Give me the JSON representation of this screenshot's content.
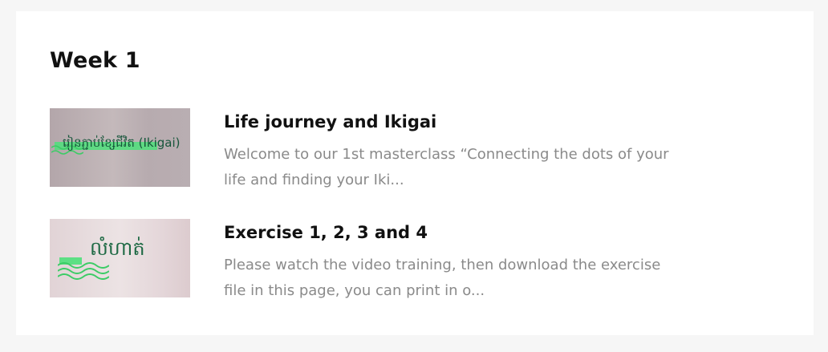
{
  "week": {
    "title": "Week 1"
  },
  "lessons": [
    {
      "thumbnail_text": "រៀនភ្ជាប់ខ្សែជីវិត (Ikigai)",
      "title": "Life journey and Ikigai",
      "description": "Welcome to our 1st masterclass  “Connecting the dots of your life and finding your Iki..."
    },
    {
      "thumbnail_text": "លំហាត់",
      "title": "Exercise 1, 2, 3 and 4",
      "description": "Please watch the video training, then download the exercise file in this page, you can print in o..."
    }
  ],
  "colors": {
    "accent_green": "#4ee07a",
    "title_text": "#111111",
    "description_text": "#8a8a8a"
  }
}
